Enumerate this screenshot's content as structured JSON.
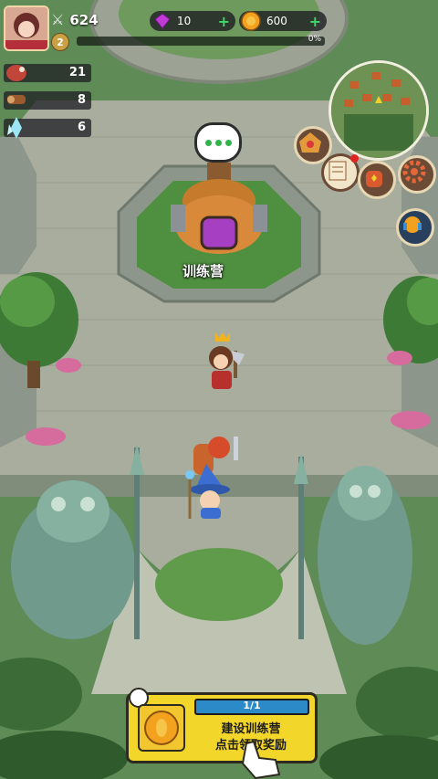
{
  "hud": {
    "power": "624",
    "level": "2",
    "xp_percent_text": "0%",
    "gems": "10",
    "coins": "600"
  },
  "resources": [
    {
      "name": "meat",
      "value": "21"
    },
    {
      "name": "wood",
      "value": "8"
    },
    {
      "name": "crystal",
      "value": "6"
    }
  ],
  "building": {
    "label": "训练营"
  },
  "quest": {
    "progress": "1/1",
    "line1": "建设训练营",
    "line2": "点击领取奖励"
  },
  "colors": {
    "grass": "#5d8a55",
    "stone": "#a9b0a0",
    "quest": "#f3d62a",
    "gem": "#c13ad6",
    "coin": "#f2a21e"
  }
}
